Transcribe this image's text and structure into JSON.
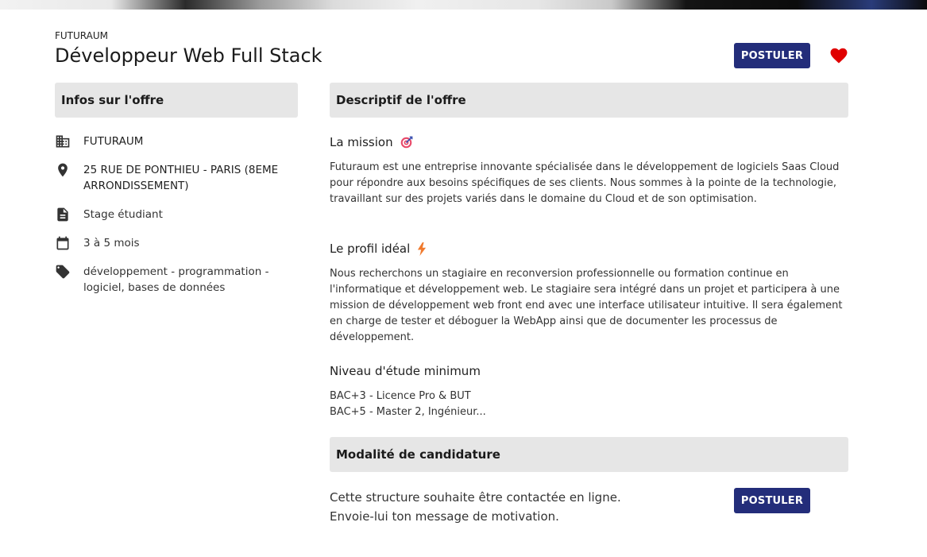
{
  "header": {
    "company": "FUTURAUM",
    "title": "Développeur Web Full Stack",
    "apply_label": "POSTULER"
  },
  "info": {
    "heading": "Infos sur l'offre",
    "items": [
      {
        "icon": "building-icon",
        "text": "FUTURAUM"
      },
      {
        "icon": "location-pin-icon",
        "text": "25 RUE DE PONTHIEU - PARIS (8EME ARRONDISSEMENT)"
      },
      {
        "icon": "document-icon",
        "text": "Stage étudiant"
      },
      {
        "icon": "calendar-icon",
        "text": "3 à 5 mois"
      },
      {
        "icon": "tag-icon",
        "text": "développement - programmation - logiciel, bases de données"
      }
    ]
  },
  "description": {
    "heading": "Descriptif de l'offre",
    "mission_title": "La mission",
    "mission_text": "Futuraum est une entreprise innovante spécialisée dans le développement de logiciels Saas Cloud pour répondre aux besoins spécifiques de ses clients. Nous sommes à la pointe de la technologie, travaillant sur des projets variés dans le domaine du Cloud et de son optimisation.",
    "profile_title": "Le profil idéal",
    "profile_text": "Nous recherchons un stagiaire en reconversion professionnelle ou formation continue en l'informatique et développement web. Le stagiaire sera intégré dans un projet et participera à une mission de développement web front end avec une interface utilisateur intuitive. Il sera également en charge de tester et déboguer la WebApp ainsi que de documenter les processus de développement.",
    "level_title": "Niveau d'étude minimum",
    "levels": [
      "BAC+3 - Licence Pro & BUT",
      "BAC+5 - Master 2, Ingénieur..."
    ]
  },
  "application": {
    "heading": "Modalité de candidature",
    "line1": "Cette structure souhaite être contactée en ligne.",
    "line2": "Envoie-lui ton message de motivation.",
    "apply_label": "POSTULER"
  },
  "colors": {
    "accent": "#232d7a",
    "heart": "#e00000",
    "section_bg": "#e6e6e6"
  }
}
